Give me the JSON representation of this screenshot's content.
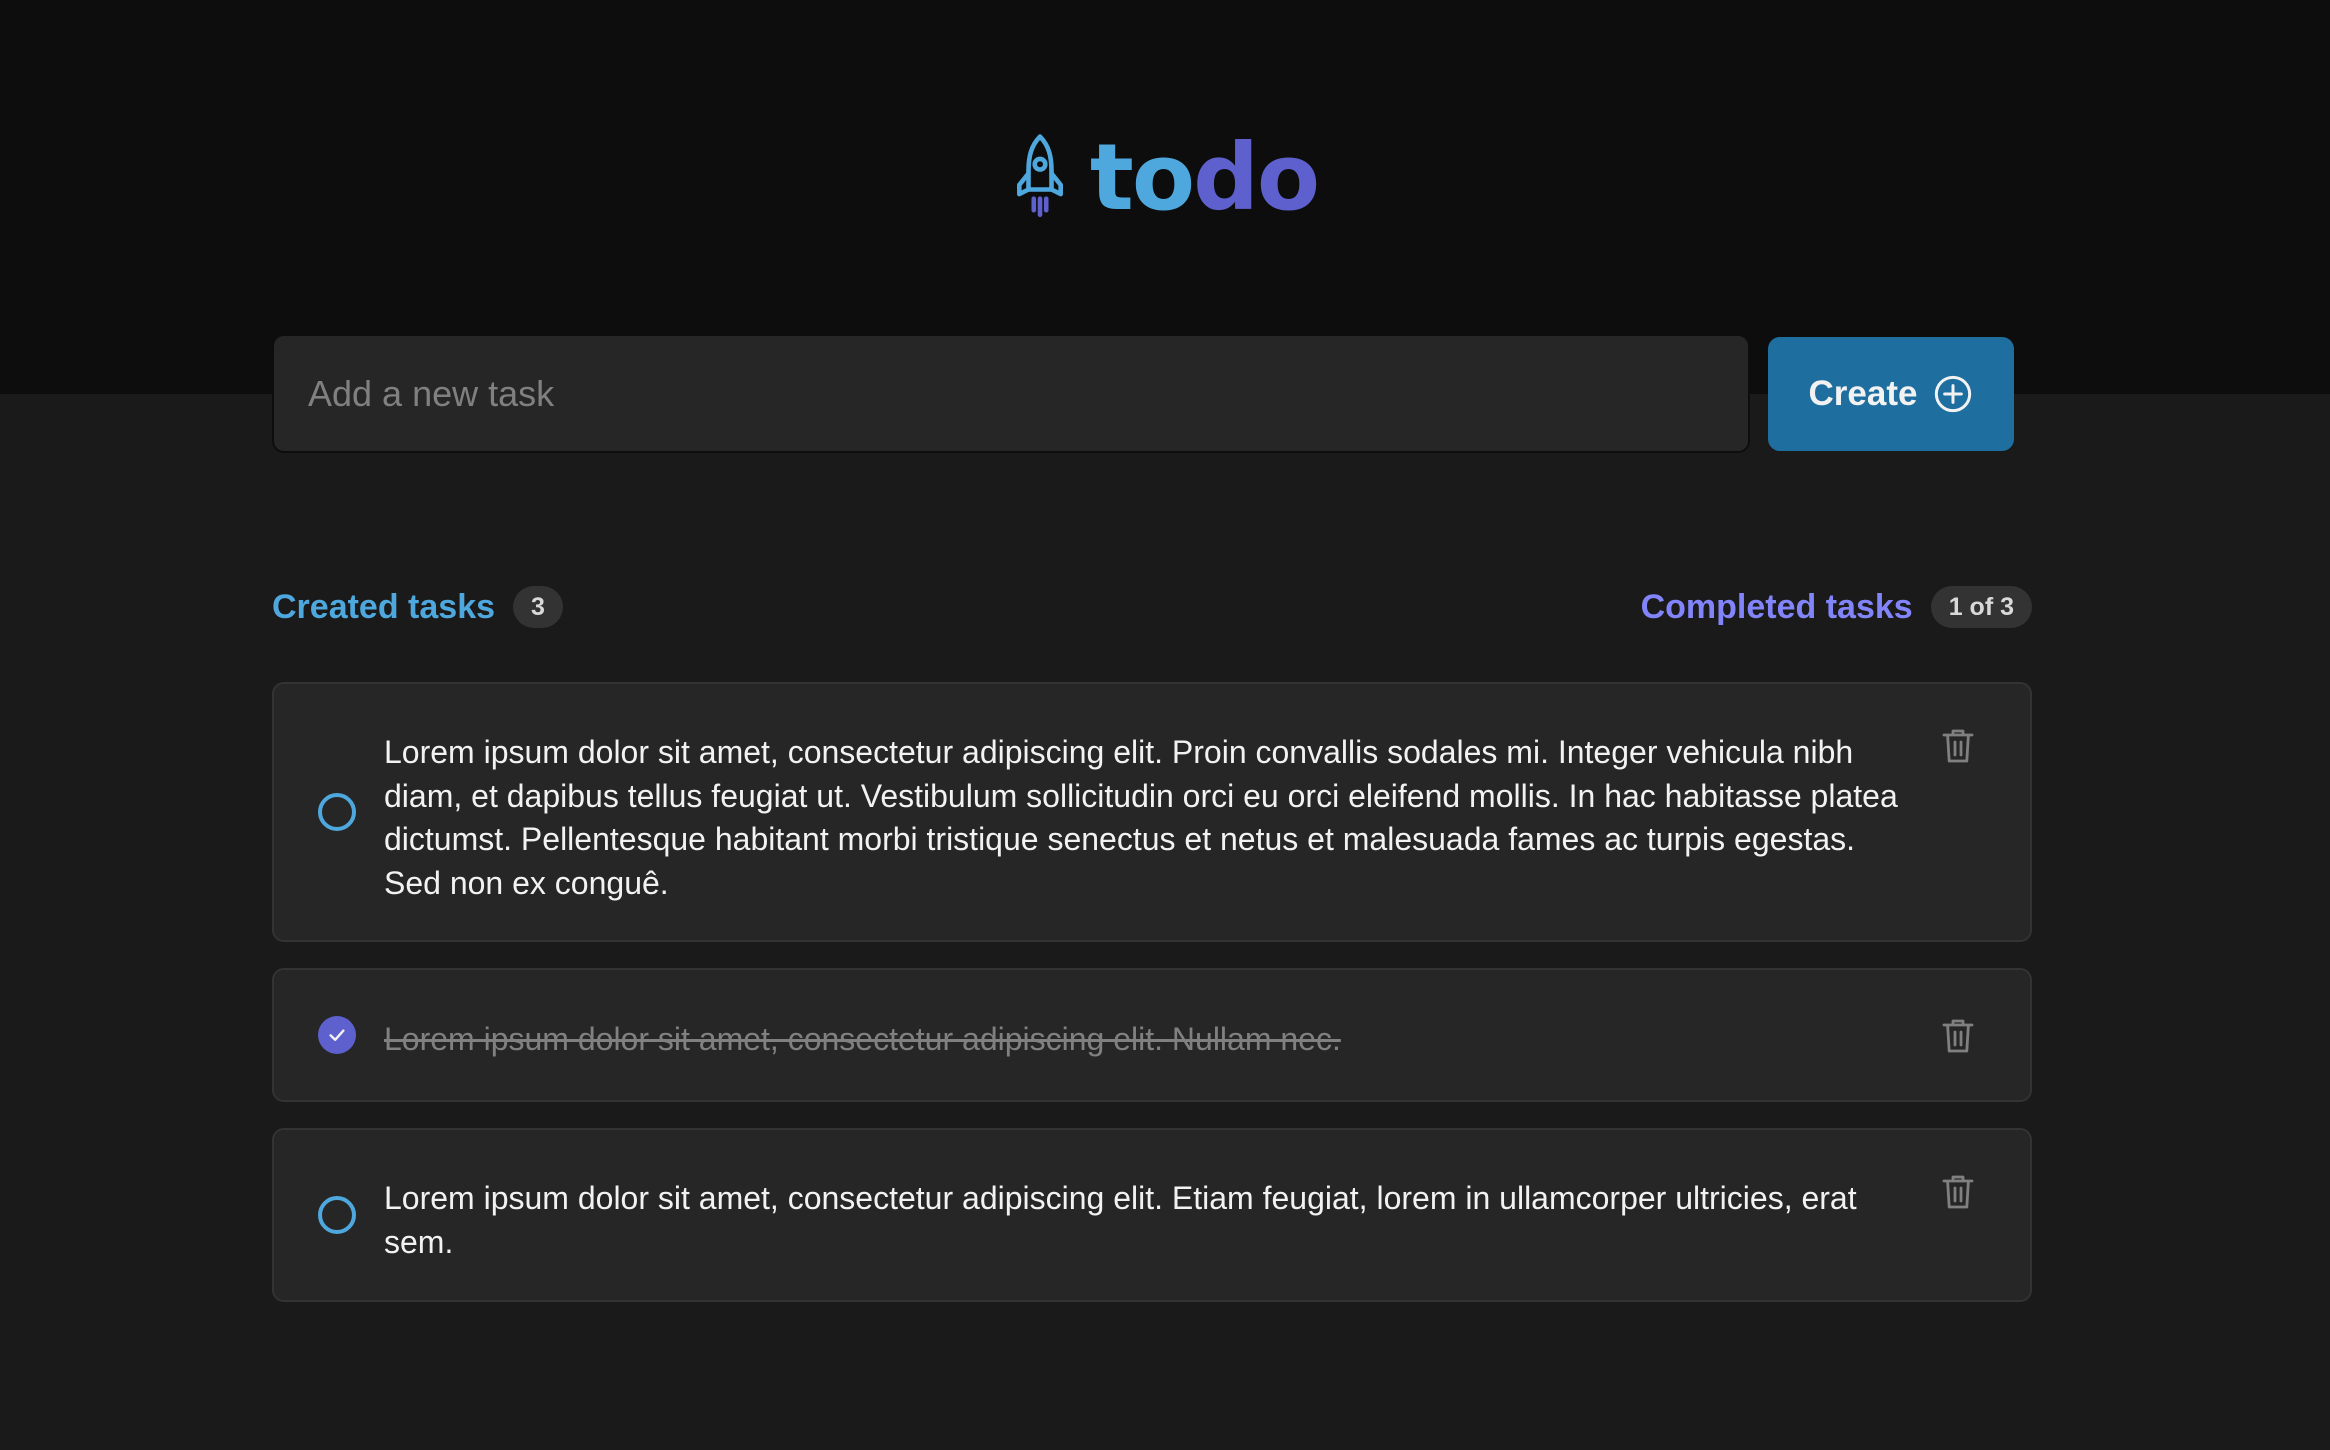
{
  "app": {
    "logo_part1": "to",
    "logo_part2": "do",
    "colors": {
      "blue": "#4ea8de",
      "purple": "#5e60ce",
      "button": "#1e6f9f"
    }
  },
  "new_task": {
    "placeholder": "Add a new task",
    "value": "",
    "create_label": "Create",
    "create_icon": "plus-circle-icon"
  },
  "summary": {
    "created_label": "Created tasks",
    "created_count": "3",
    "completed_label": "Completed tasks",
    "completed_count": "1 of 3"
  },
  "tasks": [
    {
      "text": "Lorem ipsum dolor sit amet, consectetur adipiscing elit. Proin convallis sodales mi. Integer vehicula nibh diam, et dapibus tellus feugiat ut. Vestibulum sollicitudin orci eu orci eleifend mollis. In hac habitasse platea dictumst. Pellentesque habitant morbi tristique senectus et netus et malesuada fames ac turpis egestas. Sed non ex conguê.",
      "completed": false
    },
    {
      "text": "Lorem ipsum dolor sit amet, consectetur adipiscing elit. Nullam nec.",
      "completed": true
    },
    {
      "text": "Lorem ipsum dolor sit amet, consectetur adipiscing elit. Etiam feugiat, lorem in ullamcorper ultricies, erat sem.",
      "completed": false
    }
  ]
}
